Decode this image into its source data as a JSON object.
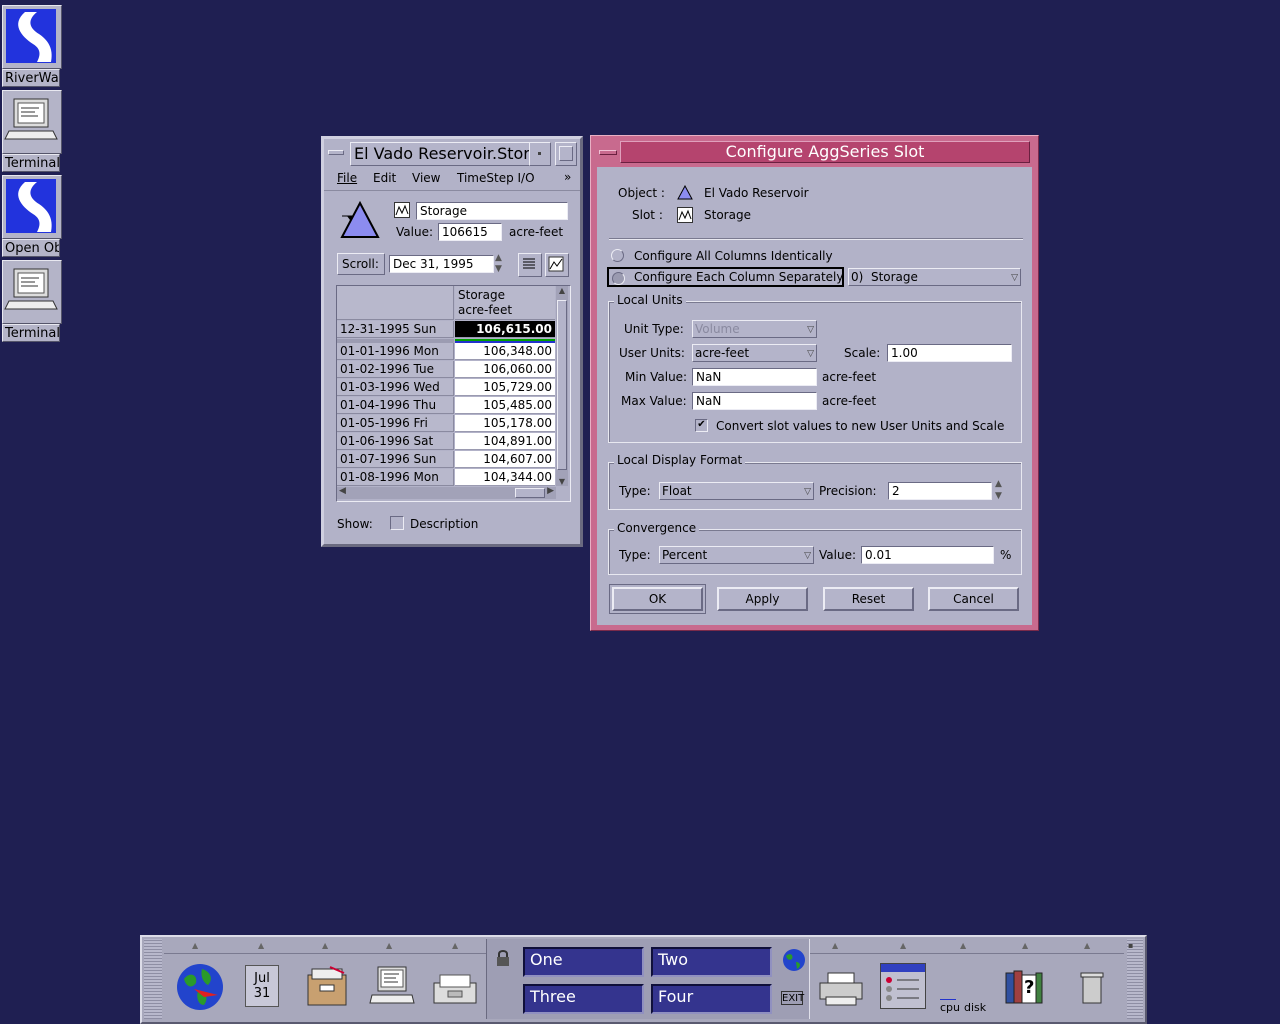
{
  "desktop_icons": [
    {
      "label": "RiverWare",
      "icon": "riverware-icon"
    },
    {
      "label": "Terminal",
      "icon": "terminal-icon"
    },
    {
      "label": "Open Object",
      "icon": "riverware-icon"
    },
    {
      "label": "Terminal",
      "icon": "terminal-icon"
    }
  ],
  "slot_window": {
    "title": "El Vado Reservoir.Storage",
    "menu": [
      "File",
      "Edit",
      "View",
      "TimeStep I/O",
      "»"
    ],
    "slot_name": "Storage",
    "value_label": "Value:",
    "value": "106615",
    "units": "acre-feet",
    "scroll_label": "Scroll:",
    "scroll_date": "Dec 31, 1995",
    "column_header_1": "Storage",
    "column_header_2": "acre-feet",
    "initial_row": {
      "date": "12-31-1995 Sun",
      "value": "106,615.00"
    },
    "rows": [
      {
        "date": "01-01-1996 Mon",
        "value": "106,348.00"
      },
      {
        "date": "01-02-1996 Tue",
        "value": "106,060.00"
      },
      {
        "date": "01-03-1996 Wed",
        "value": "105,729.00"
      },
      {
        "date": "01-04-1996 Thu",
        "value": "105,485.00"
      },
      {
        "date": "01-05-1996 Fri",
        "value": "105,178.00"
      },
      {
        "date": "01-06-1996 Sat",
        "value": "104,891.00"
      },
      {
        "date": "01-07-1996 Sun",
        "value": "104,607.00"
      },
      {
        "date": "01-08-1996 Mon",
        "value": "104,344.00"
      }
    ],
    "show_label": "Show:",
    "description_label": "Description"
  },
  "config_dialog": {
    "title": "Configure AggSeries Slot",
    "object_label": "Object :",
    "object_value": "El Vado Reservoir",
    "slot_label": "Slot :",
    "slot_value": "Storage",
    "radio_all": "Configure All Columns Identically",
    "radio_each": "Configure Each Column Separately",
    "column_select": "0)  Storage",
    "local_units": {
      "title": "Local Units",
      "unit_type_label": "Unit Type:",
      "unit_type_value": "Volume",
      "user_units_label": "User Units:",
      "user_units_value": "acre-feet",
      "scale_label": "Scale:",
      "scale_value": "1.00",
      "min_label": "Min Value:",
      "min_value": "NaN",
      "min_units": "acre-feet",
      "max_label": "Max Value:",
      "max_value": "NaN",
      "max_units": "acre-feet",
      "convert_label": "Convert slot values to new User Units and Scale",
      "convert_checked": true
    },
    "display_format": {
      "title": "Local Display Format",
      "type_label": "Type:",
      "type_value": "Float",
      "precision_label": "Precision:",
      "precision_value": "2"
    },
    "convergence": {
      "title": "Convergence",
      "type_label": "Type:",
      "type_value": "Percent",
      "value_label": "Value:",
      "value": "0.01",
      "unit": "%"
    },
    "buttons": {
      "ok": "OK",
      "apply": "Apply",
      "reset": "Reset",
      "cancel": "Cancel"
    },
    "title_color": "#b5446e"
  },
  "toolbar": {
    "calendar_month": "Jul",
    "calendar_day": "31",
    "workspaces": [
      "One",
      "Two",
      "Three",
      "Four"
    ],
    "exit_label": "EXIT",
    "cpu_label": "cpu",
    "disk_label": "disk",
    "help_label": "?"
  }
}
